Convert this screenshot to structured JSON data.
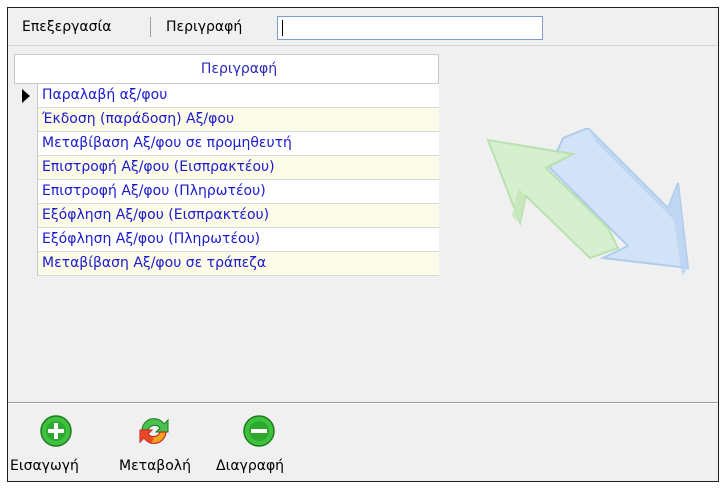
{
  "toolbar": {
    "edit_label": "Επεξεργασία",
    "description_label": "Περιγραφή",
    "search_value": ""
  },
  "grid": {
    "column_header": "Περιγραφή",
    "selected_row": 0,
    "rows": [
      "Παραλαβή αξ/φου",
      "Έκδοση (παράδοση) Αξ/φου",
      "Μεταβίβαση Αξ/φου σε προμηθευτή",
      "Επιστροφή Αξ/φου (Εισπρακτέου)",
      "Επιστροφή Αξ/φου (Πληρωτέου)",
      "Εξόφληση Αξ/φου (Εισπρακτέου)",
      "Εξόφληση Αξ/φου (Πληρωτέου)",
      "Μεταβίβαση Αξ/φου σε τράπεζα"
    ]
  },
  "actions": {
    "add_label": "Εισαγωγή",
    "edit_label": "Μεταβολή",
    "delete_label": "Διαγραφή",
    "add_icon": "plus-circle-icon",
    "edit_icon": "refresh-arrows-icon",
    "delete_icon": "minus-circle-icon"
  },
  "colors": {
    "row_text": "#1a1ad0",
    "header_text": "#2b2bb8",
    "alt_row_bg": "#fbfbe8",
    "add_green": "#35b935",
    "arrow_blue": "#bfd8f5",
    "arrow_green": "#c9ecc0"
  }
}
